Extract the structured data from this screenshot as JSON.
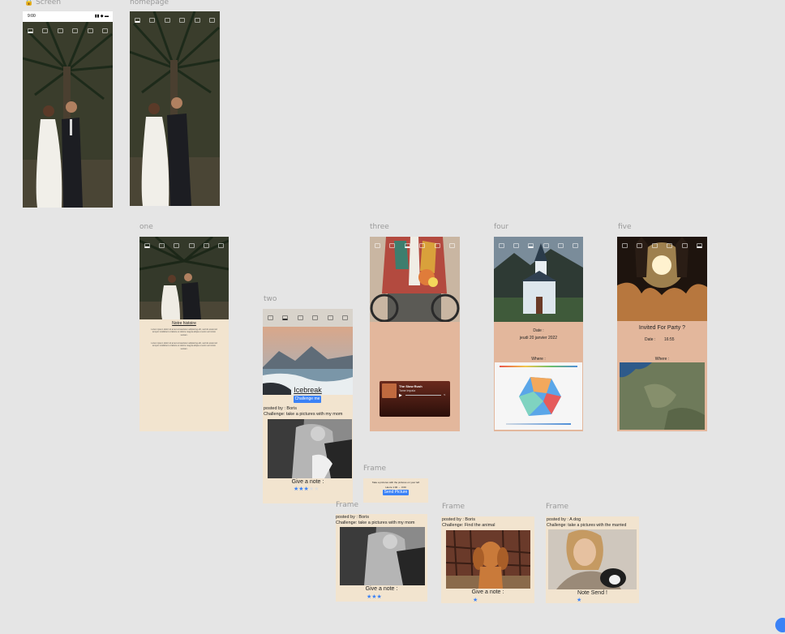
{
  "colors": {
    "canvas": "#e5e5e5",
    "beige": "#f2e4cf",
    "peach": "#e3b79c",
    "accent": "#3b82f6"
  },
  "frames": {
    "screen": {
      "label": "Screen",
      "lock_icon": "lock-icon",
      "status_time": "9:00"
    },
    "homepage": {
      "label": "homepage"
    },
    "one": {
      "label": "one",
      "heading": "Notre histoire",
      "paragraph1": "Lorem ipsum dolor sit amet consectetur adipiscing elit, sed do eiusmod tempor incididunt ut labore et dolore magna aliqua ut enim ad minim veniam.",
      "paragraph2": "Lorem ipsum dolor sit amet consectetur adipiscing elit, sed do eiusmod tempor incididunt ut labore et dolore magna aliqua ut enim ad minim veniam."
    },
    "two": {
      "label": "two",
      "title": "Icebreak",
      "button": "Challenge me",
      "posted_by": "posted by : Boris",
      "challenge": "Challenge: take a pictures with my mom",
      "give_note": "Give a note :",
      "stars_on": "★★★",
      "stars_off": "★★"
    },
    "three": {
      "label": "three",
      "song_title": "The Slow Rush",
      "artist": "Tame Impala"
    },
    "four": {
      "label": "four",
      "date_label": "Date :",
      "date_value": "jeudi 20 janvier 2022",
      "where_label": "Where :"
    },
    "five": {
      "label": "five",
      "title": "Invited For Party ?",
      "date_label": "Date :",
      "date_value": "16:55",
      "where_label": "Where :"
    },
    "frame_send": {
      "label": "Frame",
      "text": "Take a pictures with the pictures on your left",
      "subtext": "Heure 1:00 → 3:00",
      "button": "Send Picture"
    },
    "frame_a": {
      "label": "Frame",
      "posted_by": "posted by : Boris",
      "challenge": "Challenge: take a pictures with my mom",
      "give_note": "Give a note :",
      "stars": "★★★"
    },
    "frame_b": {
      "label": "Frame",
      "posted_by": "posted by : Boris",
      "challenge": "Challenge: Find the animal",
      "give_note": "Give a note :",
      "stars": "★"
    },
    "frame_c": {
      "label": "Frame",
      "posted_by": "posted by : A dog",
      "challenge": "Challenge: take a pictures with the married",
      "note_sent": "Note Send !",
      "stars": "★"
    }
  }
}
